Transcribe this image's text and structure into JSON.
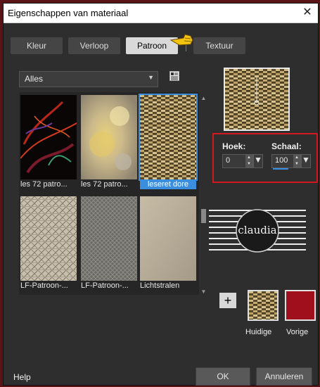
{
  "dialog": {
    "title": "Eigenschappen van materiaal",
    "close_glyph": "✕"
  },
  "tabs": [
    {
      "label": "Kleur",
      "active": false
    },
    {
      "label": "Verloop",
      "active": false
    },
    {
      "label": "Patroon",
      "active": true
    },
    {
      "label": "Textuur",
      "active": false
    }
  ],
  "category": {
    "selected": "Alles"
  },
  "patterns": [
    {
      "name": "les 72 patro...",
      "selected": false
    },
    {
      "name": "les 72 patro...",
      "selected": false
    },
    {
      "name": "leseret dore",
      "selected": true
    },
    {
      "name": "LF-Patroon-...",
      "selected": false
    },
    {
      "name": "LF-Patroon-...",
      "selected": false
    },
    {
      "name": "Lichtstralen",
      "selected": false
    }
  ],
  "params": {
    "angle_label": "Hoek:",
    "angle_value": "0",
    "scale_label": "Schaal:",
    "scale_value": "100"
  },
  "logo": {
    "text": "claudia"
  },
  "swatches": {
    "add_glyph": "+",
    "current_label": "Huidige",
    "previous_label": "Vorige",
    "previous_color": "#a00f1c"
  },
  "footer": {
    "help": "Help",
    "ok": "OK",
    "cancel": "Annuleren"
  },
  "colors": {
    "highlight": "#3b8edd",
    "annotation_red": "#d21920",
    "pattern_gold": "#b49a62"
  }
}
